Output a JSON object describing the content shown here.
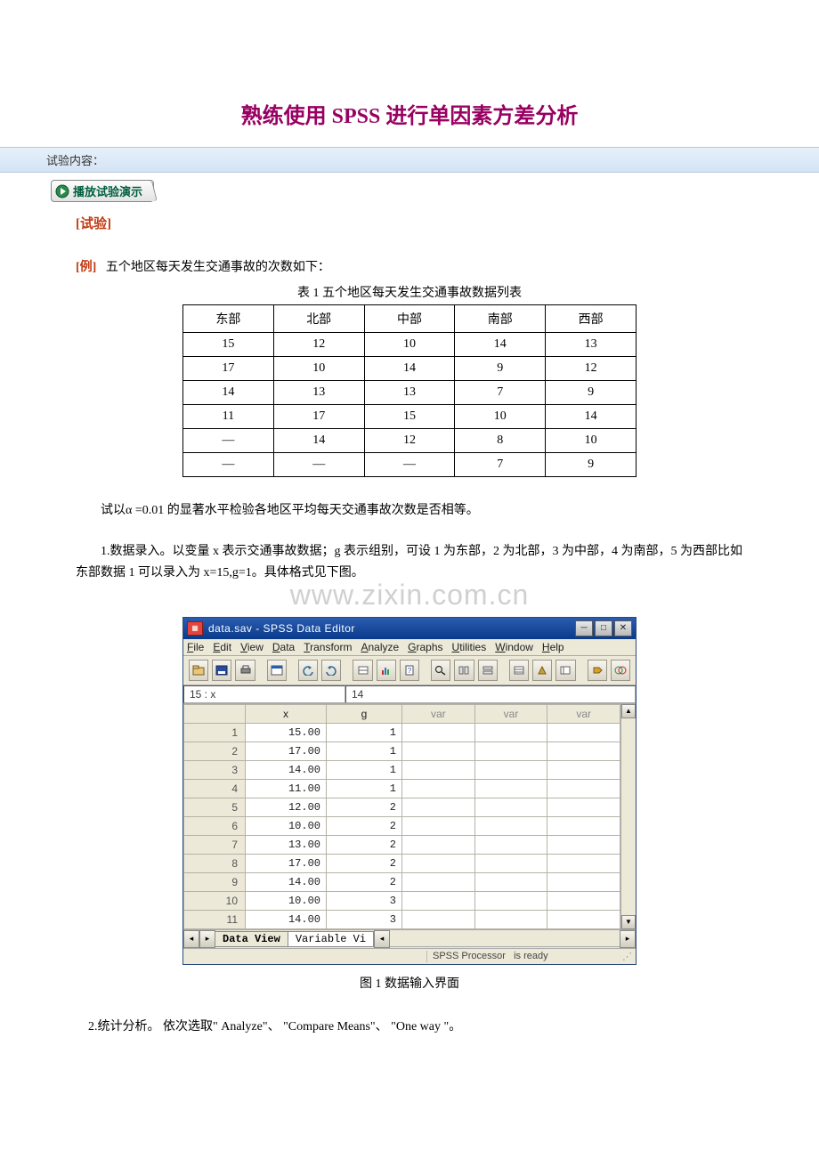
{
  "title": "熟练使用 SPSS 进行单因素方差分析",
  "header_bar": "试验内容：",
  "play_tab": "播放试验演示",
  "section_heading": "[试验]",
  "example": {
    "prefix": "[例]",
    "text": "五个地区每天发生交通事故的次数如下："
  },
  "table1": {
    "caption": "表 1  五个地区每天发生交通事故数据列表",
    "headers": [
      "东部",
      "北部",
      "中部",
      "南部",
      "西部"
    ],
    "rows": [
      [
        "15",
        "12",
        "10",
        "14",
        "13"
      ],
      [
        "17",
        "10",
        "14",
        "9",
        "12"
      ],
      [
        "14",
        "13",
        "13",
        "7",
        "9"
      ],
      [
        "11",
        "17",
        "15",
        "10",
        "14"
      ],
      [
        "—",
        "14",
        "12",
        "8",
        "10"
      ],
      [
        "—",
        "—",
        "—",
        "7",
        "9"
      ]
    ]
  },
  "alpha_line": "试以α =0.01 的显著水平检验各地区平均每天交通事故次数是否相等。",
  "step1": "1.数据录入。以变量 x  表示交通事故数据；g  表示组别，可设 1 为东部，2 为北部，3 为中部，4 为南部，5 为西部比如东部数据 1 可以录入为 x=15,g=1。具体格式见下图。",
  "watermark": "www.zixin.com.cn",
  "spss": {
    "title": "data.sav - SPSS Data Editor",
    "menu": [
      "File",
      "Edit",
      "View",
      "Data",
      "Transform",
      "Analyze",
      "Graphs",
      "Utilities",
      "Window",
      "Help"
    ],
    "cell_name": "15 : x",
    "cell_value": "14",
    "columns": [
      "x",
      "g",
      "var",
      "var",
      "var"
    ],
    "rows": [
      {
        "n": "1",
        "x": "15.00",
        "g": "1"
      },
      {
        "n": "2",
        "x": "17.00",
        "g": "1"
      },
      {
        "n": "3",
        "x": "14.00",
        "g": "1"
      },
      {
        "n": "4",
        "x": "11.00",
        "g": "1"
      },
      {
        "n": "5",
        "x": "12.00",
        "g": "2"
      },
      {
        "n": "6",
        "x": "10.00",
        "g": "2"
      },
      {
        "n": "7",
        "x": "13.00",
        "g": "2"
      },
      {
        "n": "8",
        "x": "17.00",
        "g": "2"
      },
      {
        "n": "9",
        "x": "14.00",
        "g": "2"
      },
      {
        "n": "10",
        "x": "10.00",
        "g": "3"
      },
      {
        "n": "11",
        "x": "14.00",
        "g": "3"
      }
    ],
    "tabs": {
      "active": "Data View",
      "other": "Variable Vi"
    },
    "status_left": "SPSS Processor",
    "status_right": "is ready"
  },
  "fig1_caption": "图 1   数据输入界面",
  "step2": "2.统计分析。  依次选取\" Analyze\"、  \"Compare Means\"、  \"One way \"。"
}
